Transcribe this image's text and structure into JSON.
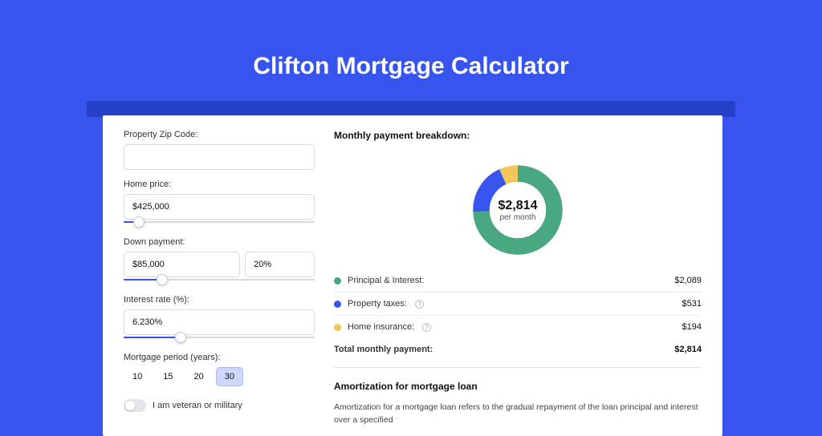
{
  "title": "Clifton Mortgage Calculator",
  "colors": {
    "principal": "#49a882",
    "taxes": "#3755ee",
    "insurance": "#f1c75c"
  },
  "form": {
    "zip_label": "Property Zip Code:",
    "zip_value": "",
    "price_label": "Home price:",
    "price_value": "$425,000",
    "price_slider_pct": 8,
    "down_label": "Down payment:",
    "down_amount": "$85,000",
    "down_pct": "20%",
    "down_slider_pct": 20,
    "rate_label": "Interest rate (%):",
    "rate_value": "6.230%",
    "rate_slider_pct": 30,
    "period_label": "Mortgage period (years):",
    "periods": [
      "10",
      "15",
      "20",
      "30"
    ],
    "period_selected": "30",
    "vet_label": "I am veteran or military"
  },
  "breakdown": {
    "title": "Monthly payment breakdown:",
    "center_amount": "$2,814",
    "center_sub": "per month",
    "items": [
      {
        "label": "Principal & Interest:",
        "value": "$2,089",
        "color_key": "principal",
        "help": false
      },
      {
        "label": "Property taxes:",
        "value": "$531",
        "color_key": "taxes",
        "help": true
      },
      {
        "label": "Home insurance:",
        "value": "$194",
        "color_key": "insurance",
        "help": true
      }
    ],
    "total_label": "Total monthly payment:",
    "total_value": "$2,814"
  },
  "amort": {
    "title": "Amortization for mortgage loan",
    "body": "Amortization for a mortgage loan refers to the gradual repayment of the loan principal and interest over a specified"
  },
  "chart_data": {
    "type": "pie",
    "title": "Monthly payment breakdown",
    "series": [
      {
        "name": "Principal & Interest",
        "value": 2089
      },
      {
        "name": "Property taxes",
        "value": 531
      },
      {
        "name": "Home insurance",
        "value": 194
      }
    ],
    "total": 2814,
    "donut_hole_pct": 64
  }
}
